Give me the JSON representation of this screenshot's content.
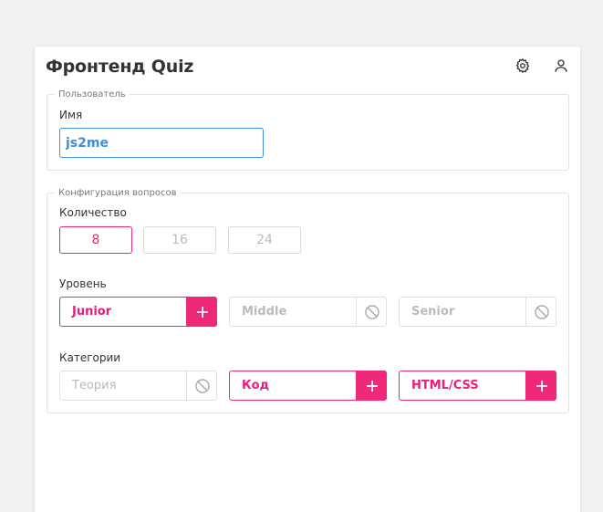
{
  "app": {
    "title": "Фронтенд Quiz"
  },
  "header": {
    "settings_icon": "gear-icon",
    "profile_icon": "user-icon"
  },
  "user_section": {
    "legend": "Пользователь",
    "name_label": "Имя",
    "name_value": "js2me"
  },
  "config_section": {
    "legend": "Конфигурация вопросов",
    "count": {
      "label": "Количество",
      "options": [
        {
          "label": "8",
          "selected": true
        },
        {
          "label": "16",
          "selected": false
        },
        {
          "label": "24",
          "selected": false
        }
      ]
    },
    "level": {
      "label": "Уровень",
      "options": [
        {
          "label": "Junior",
          "enabled": true
        },
        {
          "label": "Middle",
          "enabled": false
        },
        {
          "label": "Senior",
          "enabled": false
        }
      ]
    },
    "categories": {
      "label": "Категории",
      "options": [
        {
          "label": "Теория",
          "enabled": false
        },
        {
          "label": "Код",
          "enabled": true
        },
        {
          "label": "HTML/CSS",
          "enabled": true
        }
      ]
    }
  },
  "colors": {
    "accent": "#f0287a",
    "focus": "#3b8fdc",
    "muted": "#bbbbbb"
  }
}
